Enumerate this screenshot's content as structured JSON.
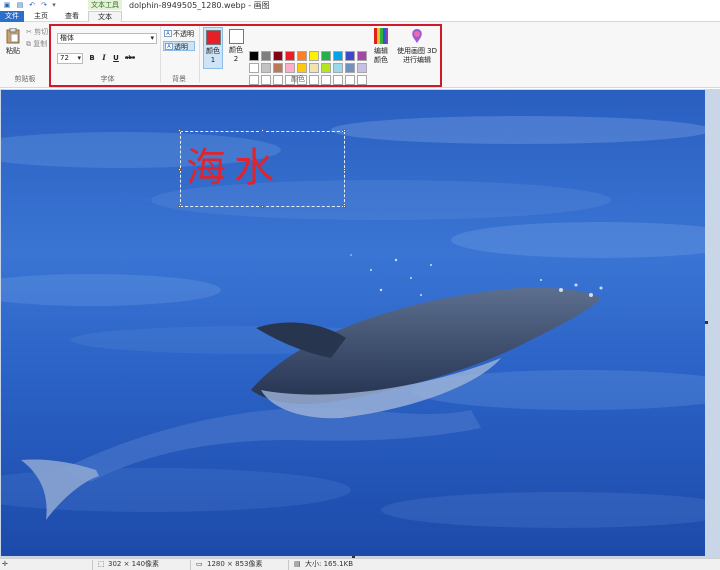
{
  "titlebar": {
    "context_tab": "文本工具",
    "title": "dolphin-8949505_1280.webp - 画图"
  },
  "tabs": [
    {
      "label": "文件"
    },
    {
      "label": "主页"
    },
    {
      "label": "查看"
    },
    {
      "label": "文本"
    }
  ],
  "clipboard": {
    "paste": "粘贴",
    "cut": "剪切",
    "copy": "复制",
    "group": "剪贴板"
  },
  "font": {
    "family": "楷体",
    "size": "72",
    "bold": "B",
    "italic": "I",
    "underline": "U",
    "strike": "abc",
    "group": "字体"
  },
  "background": {
    "opaque": "不透明",
    "transparent": "透明",
    "group": "背景"
  },
  "colors": {
    "color1_label": "颜色 1",
    "color2_label": "颜色 2",
    "color1": "#e5202b",
    "color2": "#ffffff",
    "edit": "编辑颜色",
    "paint3d": "使用画图 3D 进行编辑",
    "group": "颜色",
    "palette": [
      "#000000",
      "#7f7f7f",
      "#880015",
      "#ed1c24",
      "#ff7f27",
      "#fff200",
      "#22b14c",
      "#00a2e8",
      "#3f48cc",
      "#a349a4",
      "#ffffff",
      "#c3c3c3",
      "#b97a57",
      "#ffaec9",
      "#ffc90e",
      "#efe4b0",
      "#b5e61d",
      "#99d9ea",
      "#7092be",
      "#c8bfe7",
      "#ffffff",
      "#ffffff",
      "#ffffff",
      "#ffffff",
      "#ffffff",
      "#ffffff",
      "#ffffff",
      "#ffffff",
      "#ffffff",
      "#ffffff"
    ]
  },
  "canvas": {
    "text": "海水"
  },
  "status": {
    "selection": "302 × 140像素",
    "image_size": "1280 × 853像素",
    "file_size": "大小: 165.1KB"
  }
}
